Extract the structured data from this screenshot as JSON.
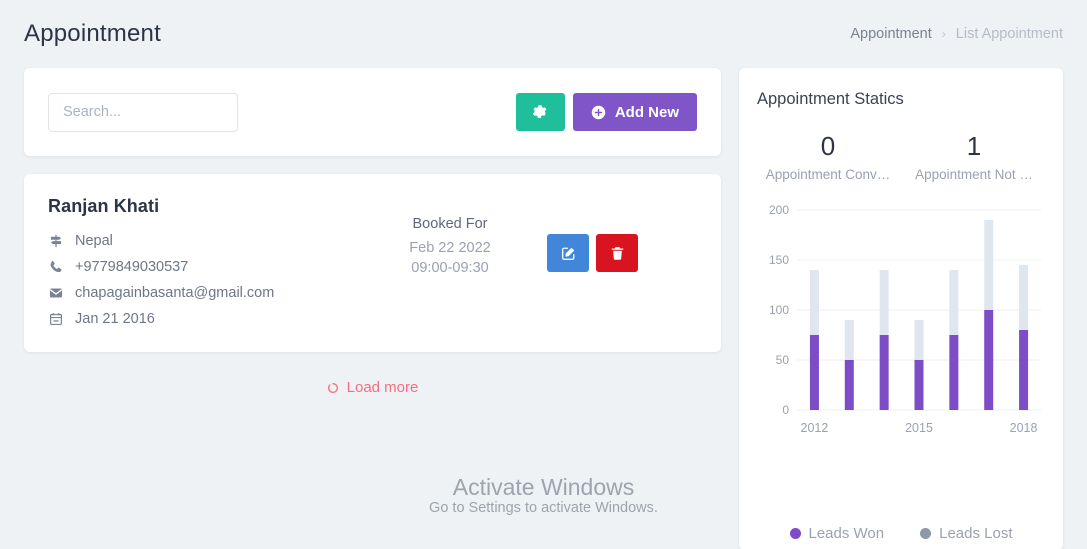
{
  "header": {
    "title": "Appointment",
    "breadcrumb": {
      "parent": "Appointment",
      "separator": "›",
      "current": "List Appointment"
    }
  },
  "toolbar": {
    "search_placeholder": "Search...",
    "search_value": "",
    "settings_icon": "gear-icon",
    "add_new_label": "Add New",
    "add_new_icon": "plus-circle-icon"
  },
  "appointment": {
    "name": "Ranjan Khati",
    "details": [
      {
        "icon": "signpost-icon",
        "text": "Nepal"
      },
      {
        "icon": "phone-icon",
        "text": "+9779849030537"
      },
      {
        "icon": "envelope-icon",
        "text": "chapagainbasanta@gmail.com"
      },
      {
        "icon": "calendar-icon",
        "text": "Jan 21 2016"
      }
    ],
    "booked_label": "Booked For",
    "booked_date": "Feb 22 2022",
    "booked_time": "09:00-09:30",
    "edit_icon": "pencil-square-icon",
    "delete_icon": "trash-icon"
  },
  "load_more": {
    "label": "Load more",
    "icon": "spinner-icon"
  },
  "statistics": {
    "title": "Appointment Statics",
    "counters": [
      {
        "value": "0",
        "label": "Appointment Conv…"
      },
      {
        "value": "1",
        "label": "Appointment Not …"
      }
    ]
  },
  "watermark": {
    "title": "Activate Windows",
    "subtitle": "Go to Settings to activate Windows."
  },
  "colors": {
    "page_background": "#eef2f5",
    "accent_purple": "#8055c8",
    "accent_teal": "#1fbf9c",
    "edit_blue": "#4186d8",
    "delete_red": "#d91421",
    "load_more_red": "#f3707e",
    "bar_won": "#7c4dc7",
    "bar_lost": "#dfe6ef"
  },
  "chart_data": {
    "type": "bar",
    "title": "",
    "stacked": true,
    "categories": [
      "2012",
      "2013",
      "2014",
      "2015",
      "2016",
      "2017",
      "2018"
    ],
    "tick_labels": [
      "2012",
      "",
      "",
      "2015",
      "",
      "",
      "2018"
    ],
    "series": [
      {
        "name": "Leads Won",
        "color": "#7c4dc7",
        "values": [
          75,
          50,
          75,
          50,
          75,
          100,
          80
        ]
      },
      {
        "name": "Leads Lost",
        "color": "#dfe6ef",
        "values": [
          65,
          40,
          65,
          40,
          65,
          90,
          65
        ]
      }
    ],
    "totals": [
      140,
      90,
      140,
      90,
      140,
      190,
      145
    ],
    "ylim": [
      0,
      200
    ],
    "yticks": [
      0,
      50,
      100,
      150,
      200
    ],
    "xlabel": "",
    "ylabel": "",
    "grid": true,
    "legend_position": "bottom",
    "legend": [
      {
        "label": "Leads Won",
        "color": "#7c4dc7"
      },
      {
        "label": "Leads Lost",
        "color": "#8e99a8"
      }
    ]
  }
}
